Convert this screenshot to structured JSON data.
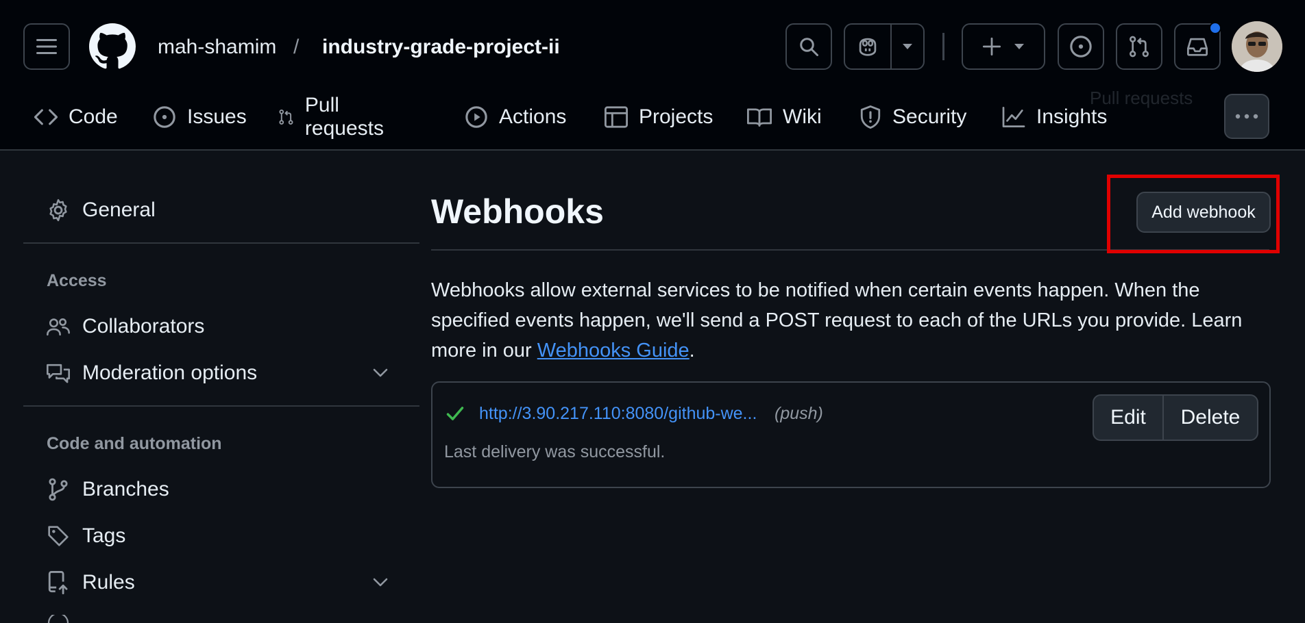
{
  "header": {
    "owner": "mah-shamim",
    "separator": "/",
    "repo": "industry-grade-project-ii",
    "tooltip_ghost": "Pull requests"
  },
  "tabs": [
    {
      "label": "Code",
      "icon": "code-icon"
    },
    {
      "label": "Issues",
      "icon": "issue-icon"
    },
    {
      "label": "Pull requests",
      "icon": "pull-request-icon"
    },
    {
      "label": "Actions",
      "icon": "play-icon"
    },
    {
      "label": "Projects",
      "icon": "table-icon"
    },
    {
      "label": "Wiki",
      "icon": "book-icon"
    },
    {
      "label": "Security",
      "icon": "shield-icon"
    },
    {
      "label": "Insights",
      "icon": "graph-icon"
    }
  ],
  "sidebar": {
    "general": "General",
    "access_heading": "Access",
    "collaborators": "Collaborators",
    "moderation": "Moderation options",
    "code_heading": "Code and automation",
    "branches": "Branches",
    "tags": "Tags",
    "rules": "Rules"
  },
  "main": {
    "title": "Webhooks",
    "add_button": "Add webhook",
    "desc_text": "Webhooks allow external services to be notified when certain events happen. When the specified events happen, we'll send a POST request to each of the URLs you provide. Learn more in our ",
    "desc_link": "Webhooks Guide",
    "desc_end": ".",
    "hook": {
      "url": "http://3.90.217.110:8080/github-we...",
      "events": "(push)",
      "status": "Last delivery was successful.",
      "edit": "Edit",
      "delete": "Delete"
    }
  },
  "colors": {
    "accent_link": "#4493f8",
    "success": "#3fb950",
    "highlight": "#e00000",
    "notification": "#1f6feb"
  }
}
